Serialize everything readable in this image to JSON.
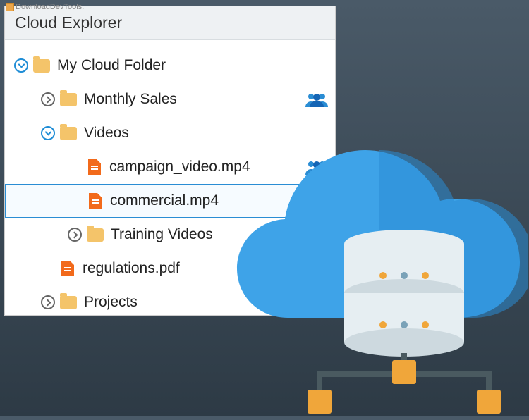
{
  "watermark": "DownloadDevTools.",
  "panel": {
    "title": "Cloud Explorer"
  },
  "tree": {
    "root": {
      "label": "My Cloud Folder",
      "children": [
        {
          "label": "Monthly Sales",
          "shared": true,
          "type": "folder",
          "expanded": false
        },
        {
          "label": "Videos",
          "type": "folder",
          "expanded": true,
          "children": [
            {
              "label": "campaign_video.mp4",
              "type": "file",
              "shared": true
            },
            {
              "label": "commercial.mp4",
              "type": "file",
              "shared": true,
              "selected": true
            },
            {
              "label": "Training Videos",
              "type": "folder",
              "expanded": false
            }
          ]
        },
        {
          "label": "regulations.pdf",
          "type": "file"
        },
        {
          "label": "Projects",
          "type": "folder",
          "expanded": false
        }
      ]
    }
  },
  "colors": {
    "accent": "#1f8dd6",
    "folder": "#f4c46a",
    "file": "#f26a1b",
    "cloud": "#3ea3e8"
  }
}
